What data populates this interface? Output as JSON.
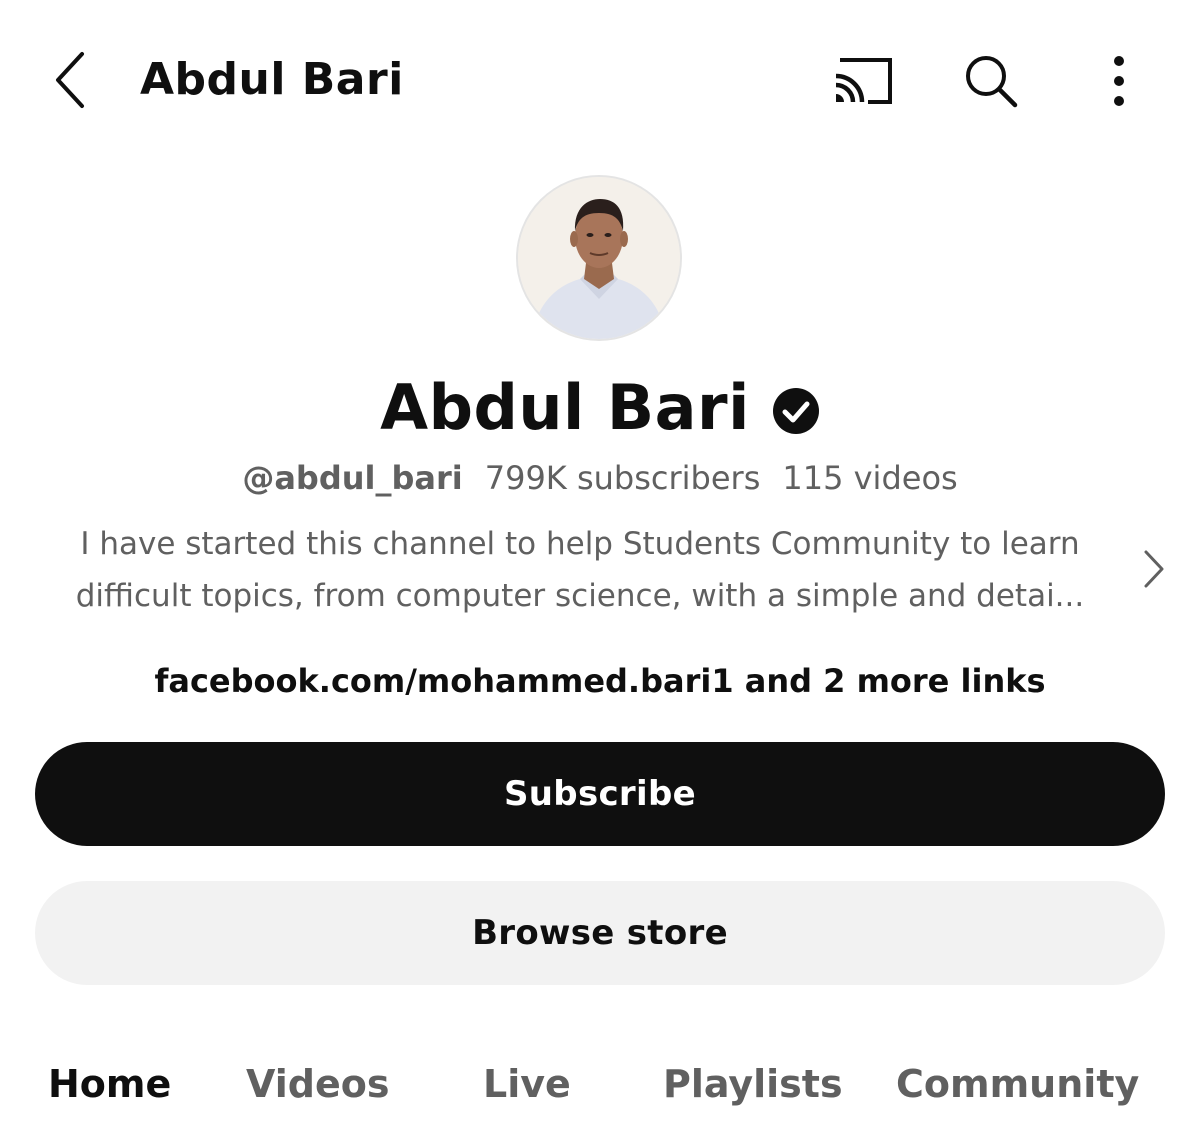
{
  "header": {
    "title": "Abdul Bari",
    "icons": [
      "back-arrow-icon",
      "cast-icon",
      "search-icon",
      "more-vert-icon"
    ]
  },
  "channel": {
    "name": "Abdul Bari",
    "verified": true,
    "handle": "@abdul_bari",
    "subscribers": "799K subscribers",
    "videos": "115 videos",
    "description_line1": "I have started this channel to help Students Community to learn",
    "description_line2": "difficult topics, from computer science,  with a simple and detai...",
    "links": "facebook.com/mohammed.bari1 and 2 more links"
  },
  "actions": {
    "subscribe_label": "Subscribe",
    "store_label": "Browse store"
  },
  "tabs": [
    {
      "label": "Home",
      "active": true
    },
    {
      "label": "Videos",
      "active": false
    },
    {
      "label": "Live",
      "active": false
    },
    {
      "label": "Playlists",
      "active": false
    },
    {
      "label": "Community",
      "active": false
    }
  ],
  "colors": {
    "primary_text": "#0f0f0f",
    "secondary_text": "#606060",
    "subscribe_bg": "#0f0f0f",
    "store_bg": "#f2f2f2"
  }
}
